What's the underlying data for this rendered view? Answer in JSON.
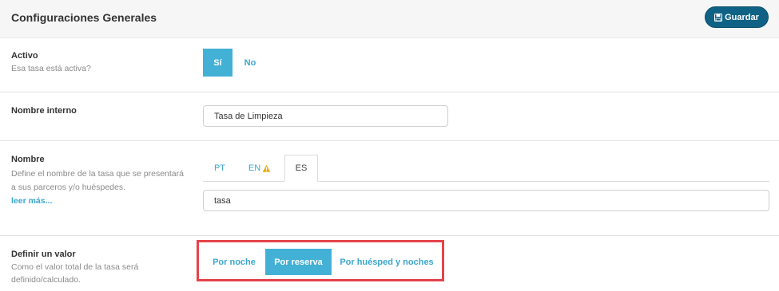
{
  "header": {
    "title": "Configuraciones Generales",
    "save_label": "Guardar",
    "save_icon": "floppy-disk-icon"
  },
  "activo": {
    "label": "Activo",
    "description": "Esa tasa está activa?",
    "toggle": {
      "on_label": "Sí",
      "off_label": "No",
      "selected": "Sí"
    }
  },
  "nombre_interno": {
    "label": "Nombre interno",
    "value": "Tasa de Limpieza"
  },
  "nombre": {
    "label": "Nombre",
    "description_line1": "Define el nombre de la tasa que se presentará",
    "description_line2": "a sus parceros y/o huéspedes.",
    "read_more": "leer más...",
    "tabs": [
      {
        "label": "PT",
        "warning": false
      },
      {
        "label": "EN",
        "warning": true
      },
      {
        "label": "ES",
        "warning": false
      }
    ],
    "active_tab": "ES",
    "value": "tasa"
  },
  "definir_valor": {
    "label": "Definir un valor",
    "description_line1": "Como el valor total de la tasa será",
    "description_line2": "definido/calculado.",
    "options": [
      {
        "label": "Por noche"
      },
      {
        "label": "Por reserva"
      },
      {
        "label": "Por huésped y noches"
      }
    ],
    "selected": "Por reserva"
  },
  "colors": {
    "accent": "#43b0d6",
    "link": "#3aa7d0",
    "save_button": "#0f6285",
    "highlight": "#e5434b",
    "warning": "#f0ad1c"
  }
}
